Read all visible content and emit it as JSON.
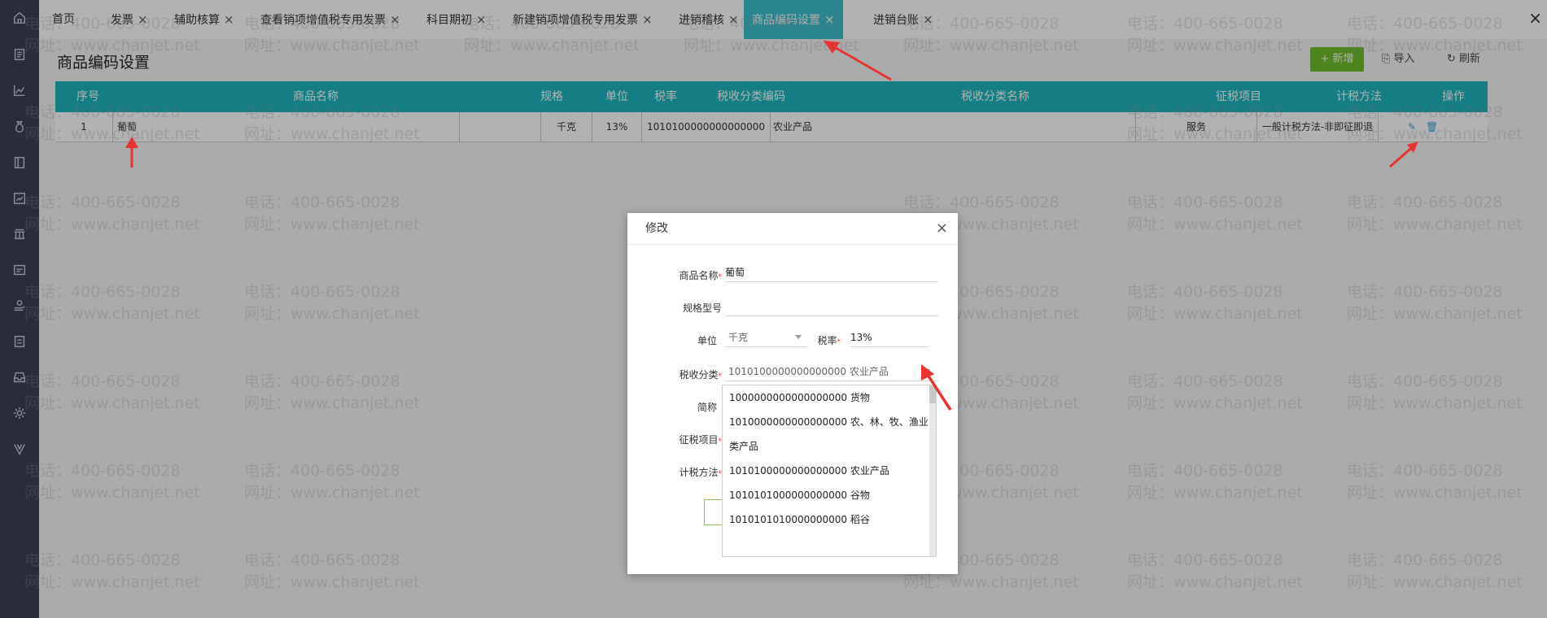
{
  "sidebar": {
    "icons": [
      "home-icon",
      "document-icon",
      "chart-icon",
      "money-bag-icon",
      "book-icon",
      "image-chart-icon",
      "building-icon",
      "card-icon",
      "hand-coin-icon",
      "invoice-icon",
      "inbox-icon",
      "gear-icon",
      "v-logo-icon"
    ]
  },
  "tabs": [
    {
      "label": "首页",
      "closable": false
    },
    {
      "label": "发票",
      "closable": true
    },
    {
      "label": "辅助核算",
      "closable": true
    },
    {
      "label": "查看销项增值税专用发票",
      "closable": true
    },
    {
      "label": "科目期初",
      "closable": true
    },
    {
      "label": "新建销项增值税专用发票",
      "closable": true
    },
    {
      "label": "进销稽核",
      "closable": true
    },
    {
      "label": "商品编码设置",
      "closable": true,
      "active": true
    },
    {
      "label": "进销台账",
      "closable": true
    }
  ],
  "close_all": "×",
  "page": {
    "title": "商品编码设置",
    "add_label": "+ 新增",
    "import_label": "导入",
    "refresh_label": "刷新"
  },
  "grid": {
    "columns": [
      "序号",
      "商品名称",
      "规格",
      "单位",
      "税率",
      "税收分类编码",
      "税收分类名称",
      "征税项目",
      "计税方法",
      "操作"
    ],
    "rows": [
      {
        "index": "1",
        "name": "葡萄",
        "spec": "",
        "unit": "千克",
        "tax_rate": "13%",
        "tax_code": "1010100000000000000",
        "tax_name": "农业产品",
        "levy_item": "服务",
        "tax_method": "一般计税方法-非即征即退"
      }
    ]
  },
  "watermark": {
    "phone": "电话：400-665-0028",
    "site": "网址：www.chanjet.net"
  },
  "modal": {
    "title": "修改",
    "close": "×",
    "fields": {
      "name_label": "商品名称",
      "name_value": "葡萄",
      "spec_label": "规格型号",
      "spec_value": "",
      "unit_label": "单位",
      "unit_value": "千克",
      "rate_label": "税率",
      "rate_value": "13%",
      "category_label": "税收分类",
      "category_value": "1010100000000000000 农业产品",
      "short_label": "简称",
      "levy_label": "征税项目",
      "method_label": "计税方法"
    },
    "dropdown_options": [
      "1000000000000000000 货物",
      "1010000000000000000 农、林、牧、渔业类产品",
      "1010100000000000000 农业产品",
      "1010101000000000000 谷物",
      "1010101010000000000 稻谷"
    ]
  },
  "colors": {
    "sidebar": "#3a3f55",
    "accent": "#1fb3bf",
    "active_tab": "#3bbfd0",
    "add_button": "#6ebd2e",
    "annotation_arrow": "#e8332f"
  }
}
